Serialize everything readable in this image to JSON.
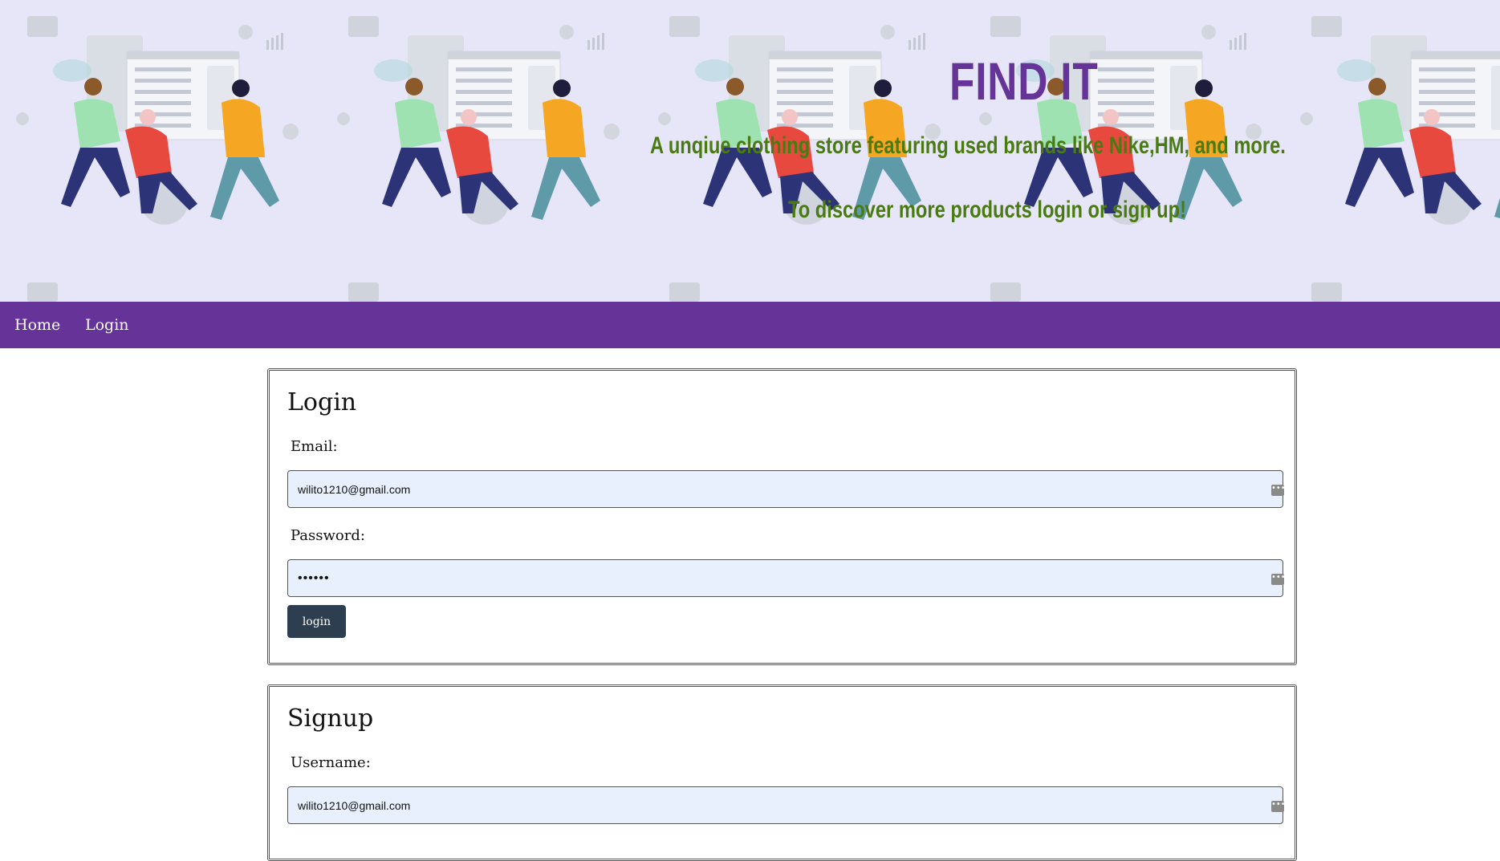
{
  "banner": {
    "brand": "FIND IT",
    "tagline": "A unqiue clothing store featuring used brands like Nike,HM, and more.",
    "cta": "To discover more products login or sign up!",
    "colors": {
      "background": "#e6e6f8",
      "brand": "#663399",
      "tagline": "#4a7a12"
    }
  },
  "nav": {
    "items": [
      {
        "label": "Home"
      },
      {
        "label": "Login"
      }
    ],
    "background": "#663399"
  },
  "login_form": {
    "title": "Login",
    "email_label": "Email:",
    "email_value": "wilito1210@gmail.com",
    "password_label": "Password:",
    "password_value": "••••••",
    "submit_label": "login"
  },
  "signup_form": {
    "title": "Signup",
    "username_label": "Username:",
    "username_value": "wilito1210@gmail.com"
  }
}
